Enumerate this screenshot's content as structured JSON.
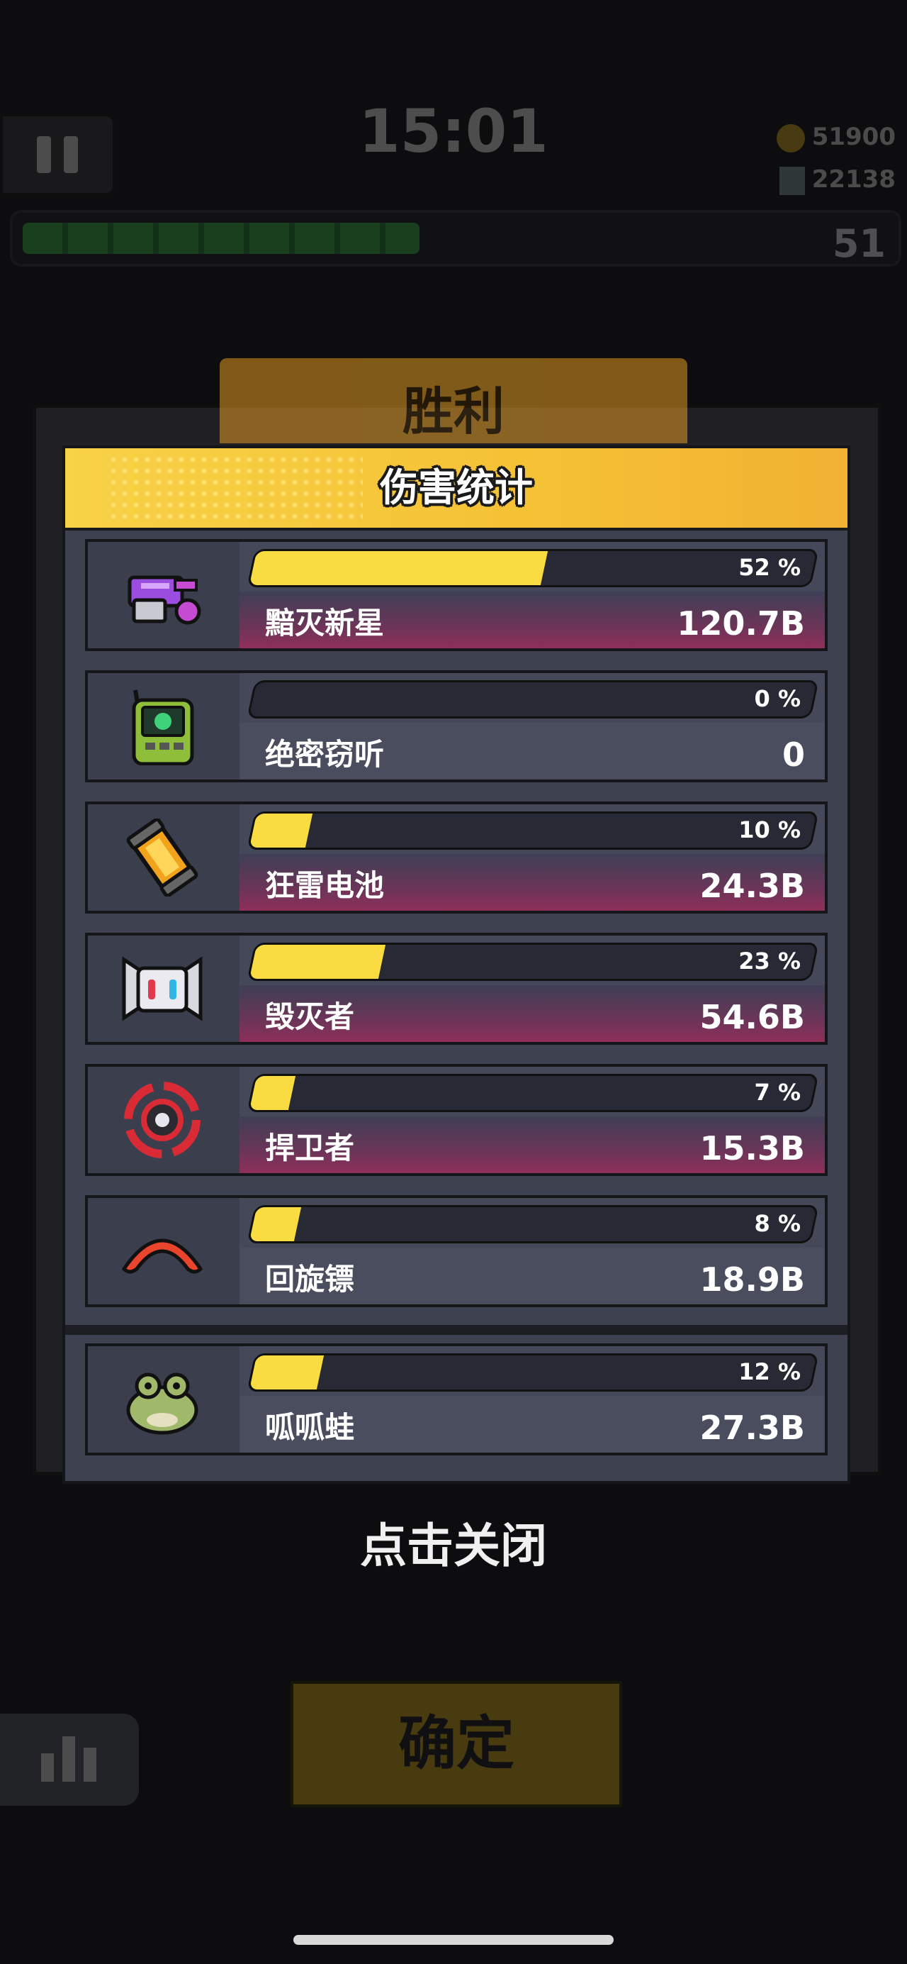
{
  "hud": {
    "timer": "15:01",
    "coins": "51900",
    "gems": "22138",
    "level": "51",
    "xp_fill_fraction": 0.46,
    "confirm_label": "确定"
  },
  "victory_title": "胜利",
  "modal": {
    "title": "伤害统计",
    "close_hint": "点击关闭"
  },
  "weapons": [
    {
      "name": "黯灭新星",
      "percent_label": "52 %",
      "percent": 52,
      "value": "120.7B",
      "icon": "purple-gun-icon",
      "highlight": true
    },
    {
      "name": "绝密窃听",
      "percent_label": "0 %",
      "percent": 0,
      "value": "0",
      "icon": "radio-device-icon",
      "highlight": false
    },
    {
      "name": "狂雷电池",
      "percent_label": "10 %",
      "percent": 10,
      "value": "24.3B",
      "icon": "battery-icon",
      "highlight": true
    },
    {
      "name": "毁灭者",
      "percent_label": "23 %",
      "percent": 23,
      "value": "54.6B",
      "icon": "robot-head-icon",
      "highlight": true
    },
    {
      "name": "捍卫者",
      "percent_label": "7 %",
      "percent": 7,
      "value": "15.3B",
      "icon": "red-shuriken-icon",
      "highlight": true
    },
    {
      "name": "回旋镖",
      "percent_label": "8 %",
      "percent": 8,
      "value": "18.9B",
      "icon": "boomerang-icon",
      "highlight": false
    }
  ],
  "pet": {
    "name": "呱呱蛙",
    "percent_label": "12 %",
    "percent": 12,
    "value": "27.3B",
    "icon": "frog-icon",
    "highlight": false
  }
}
